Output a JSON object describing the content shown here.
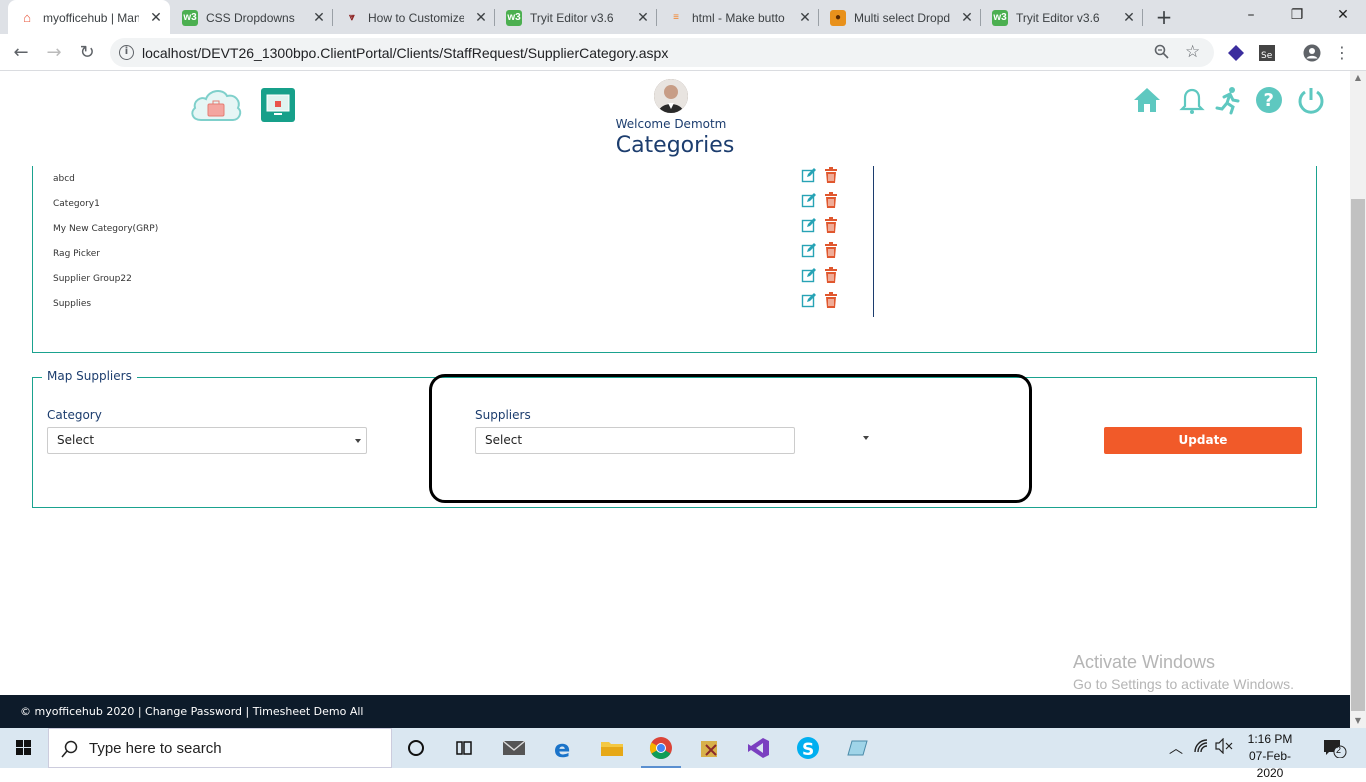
{
  "browser": {
    "tabs": [
      {
        "title": "myofficehub | Manage",
        "icon": "house-icon",
        "active": true
      },
      {
        "title": "CSS Dropdowns",
        "icon": "w3schools-icon"
      },
      {
        "title": "How to Customize",
        "icon": "bookmark-icon"
      },
      {
        "title": "Tryit Editor v3.6",
        "icon": "w3schools-icon"
      },
      {
        "title": "html - Make butto",
        "icon": "stackoverflow-icon"
      },
      {
        "title": "Multi select Dropd",
        "icon": "orange-logo-icon"
      },
      {
        "title": "Tryit Editor v3.6",
        "icon": "w3schools-icon"
      }
    ],
    "new_tab": "+",
    "window_controls": {
      "minimize": "–",
      "maximize": "❐",
      "close": "✕"
    },
    "url": "localhost/DEVT26_1300bpo.ClientPortal/Clients/StaffRequest/SupplierCategory.aspx"
  },
  "header": {
    "welcome": "Welcome Demotm",
    "title": "Categories",
    "icons": [
      "home-icon",
      "bell-icon",
      "running-person-icon",
      "help-icon",
      "power-icon"
    ]
  },
  "categories": [
    "abcd",
    "Category1",
    "My New Category(GRP)",
    "Rag Picker",
    "Supplier Group22",
    "Supplies"
  ],
  "map_suppliers": {
    "legend": "Map Suppliers",
    "category_label": "Category",
    "category_value": "Select",
    "suppliers_label": "Suppliers",
    "suppliers_value": "Select",
    "update_label": "Update"
  },
  "watermark": {
    "line1": "Activate Windows",
    "line2": "Go to Settings to activate Windows."
  },
  "footer": {
    "text": "© myofficehub 2020 | Change Password | Timesheet Demo All"
  },
  "taskbar": {
    "search_placeholder": "Type here to search",
    "time": "1:16 PM",
    "date": "07-Feb-2020",
    "notifications": "2"
  },
  "colors": {
    "teal": "#1aa28f",
    "navy": "#1c3d6e",
    "orange": "#f15a29",
    "footer_bg": "#0d1b2a"
  }
}
